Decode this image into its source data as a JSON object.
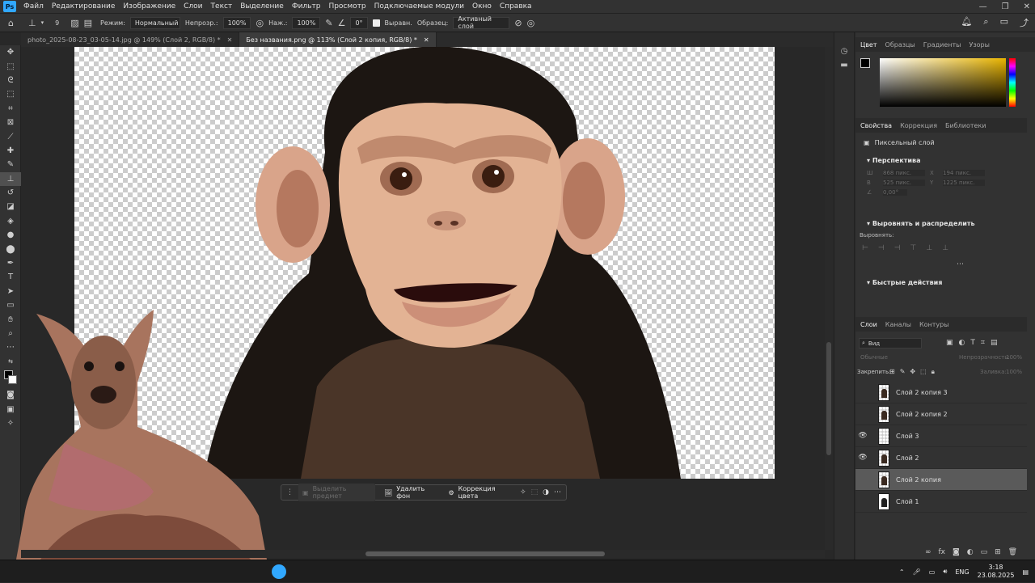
{
  "app": {
    "logo": "Ps"
  },
  "menu": [
    "Файл",
    "Редактирование",
    "Изображение",
    "Слои",
    "Текст",
    "Выделение",
    "Фильтр",
    "Просмотр",
    "Подключаемые модули",
    "Окно",
    "Справка"
  ],
  "options": {
    "brush_size": "9",
    "mode_label": "Режим:",
    "mode_value": "Нормальный",
    "opacity_label": "Непрозр.:",
    "opacity_value": "100%",
    "pressure_label": "Наж.:",
    "pressure_value": "100%",
    "angle_value": "0°",
    "align_label": "Выравн.",
    "sample_label": "Образец:",
    "sample_value": "Активный слой"
  },
  "doc_tabs": [
    {
      "label": "photo_2025-08-23_03-05-14.jpg @ 149% (Слой 2, RGB/8) *",
      "active": false
    },
    {
      "label": "Без названия.png @ 113% (Слой 2 копия, RGB/8) *",
      "active": true
    }
  ],
  "context_bar": {
    "select_subject": "Выделить предмет",
    "remove_bg": "Удалить фон",
    "color_correction": "Коррекция цвета"
  },
  "color_panel": {
    "tabs": [
      "Цвет",
      "Образцы",
      "Градиенты",
      "Узоры"
    ],
    "active": "Цвет"
  },
  "properties_panel": {
    "tabs": [
      "Свойства",
      "Коррекция",
      "Библиотеки"
    ],
    "layer_type": "Пиксельный слой",
    "perspective_title": "Перспектива",
    "w_label": "Ш",
    "w_value": "868 пикс.",
    "h_label": "В",
    "h_value": "525 пикс.",
    "x_label": "X",
    "x_value": "194 пикс.",
    "y_label": "Y",
    "y_value": "1225 пикс.",
    "angle": "0,00°",
    "align_title": "Выровнять и распределить",
    "align_sub": "Выровнять:",
    "quick_actions": "Быстрые действия"
  },
  "layers_panel": {
    "tabs": [
      "Слои",
      "Каналы",
      "Контуры"
    ],
    "filter_value": "Вид",
    "blend_mode": "Обычные",
    "opacity_label": "Непрозрачность:",
    "opacity_value": "100%",
    "lock_label": "Закрепить:",
    "fill_label": "Заливка:",
    "fill_value": "100%",
    "layers": [
      {
        "name": "Слой 2 копия 3",
        "visible": false,
        "selected": false
      },
      {
        "name": "Слой 2 копия 2",
        "visible": false,
        "selected": false
      },
      {
        "name": "Слой 3",
        "visible": true,
        "selected": false
      },
      {
        "name": "Слой 2",
        "visible": true,
        "selected": false
      },
      {
        "name": "Слой 2 копия",
        "visible": false,
        "selected": true
      },
      {
        "name": "Слой 1",
        "visible": false,
        "selected": false
      }
    ]
  },
  "taskbar": {
    "lang": "ENG",
    "time": "3:18",
    "date": "23.08.2025"
  },
  "colors": {
    "accent": "#31a8ff",
    "panel": "#323232",
    "selected": "#5a5a5a",
    "foreground": "#000000",
    "background": "#ffffff"
  }
}
